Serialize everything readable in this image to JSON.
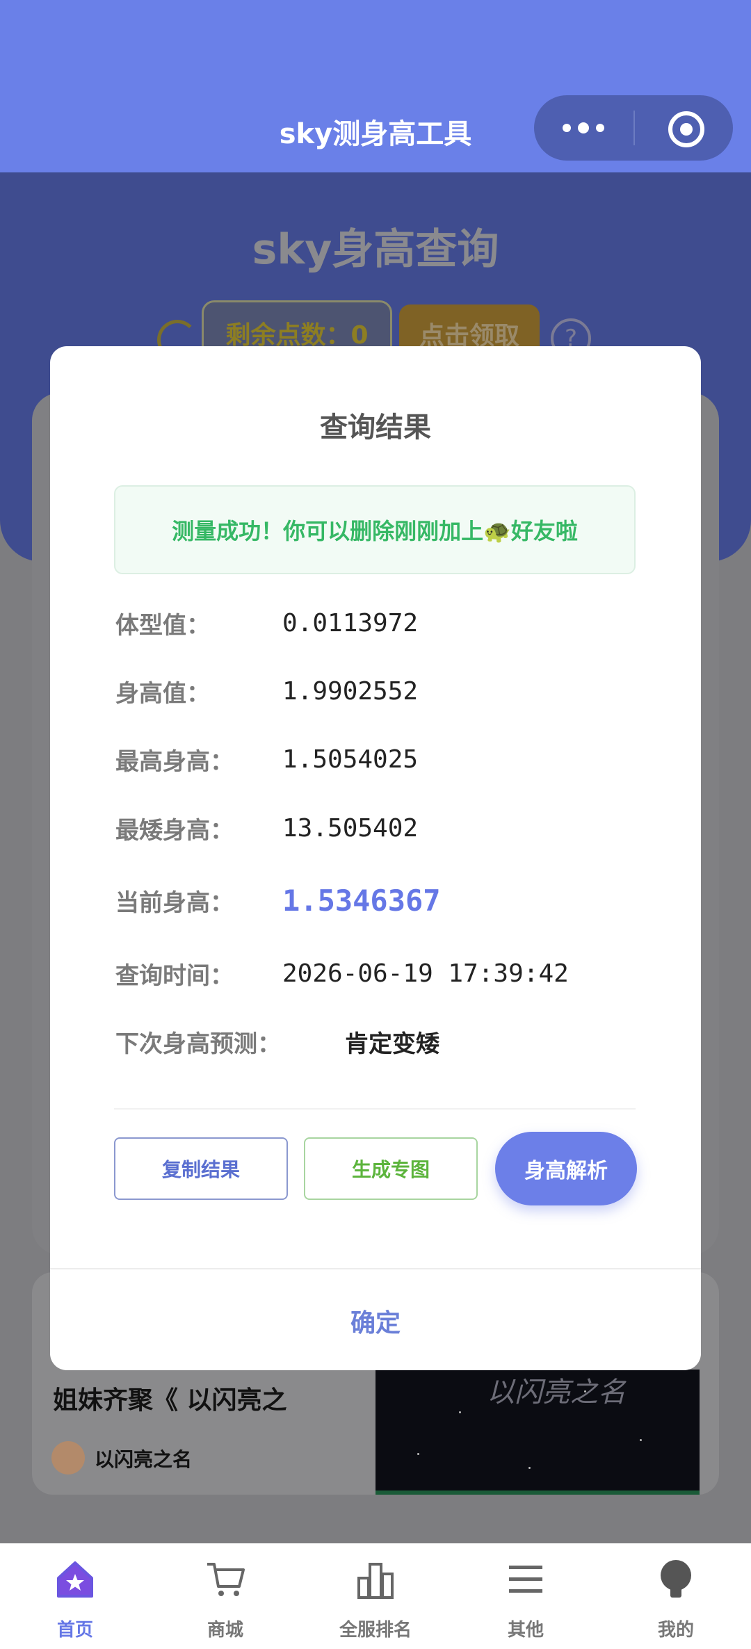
{
  "app": {
    "title": "sky测身高工具"
  },
  "header": {
    "page_title": "sky身高查询",
    "points_label": "剩余点数：0",
    "claim_button": "点击领取"
  },
  "feed": {
    "title": "姐妹齐聚《 以闪亮之",
    "author": "以闪亮之名",
    "thumb_text": "以闪亮之名"
  },
  "modal": {
    "title": "查询结果",
    "success_message": "测量成功！你可以删除刚刚加上🐢好友啦",
    "fields": [
      {
        "label": "体型值：",
        "value": "0.0113972"
      },
      {
        "label": "身高值：",
        "value": "1.9902552"
      },
      {
        "label": "最高身高：",
        "value": "1.5054025"
      },
      {
        "label": "最矮身高：",
        "value": "13.505402"
      },
      {
        "label": "当前身高：",
        "value": "1.5346367"
      },
      {
        "label": "查询时间：",
        "value": "2026-06-19 17:39:42"
      },
      {
        "label": "下次身高预测：",
        "value": "肯定变矮"
      }
    ],
    "buttons": {
      "copy": "复制结果",
      "generate": "生成专图",
      "analyze": "身高解析"
    },
    "confirm": "确定"
  },
  "tabs": [
    {
      "label": "首页",
      "icon": "home-star-icon",
      "active": true
    },
    {
      "label": "商城",
      "icon": "cart-icon",
      "active": false
    },
    {
      "label": "全服排名",
      "icon": "bar-chart-icon",
      "active": false
    },
    {
      "label": "其他",
      "icon": "menu-icon",
      "active": false
    },
    {
      "label": "我的",
      "icon": "profile-icon",
      "active": false
    }
  ],
  "colors": {
    "primary": "#6a80e8",
    "success": "#36b865",
    "accent_green": "#5cb43c"
  }
}
